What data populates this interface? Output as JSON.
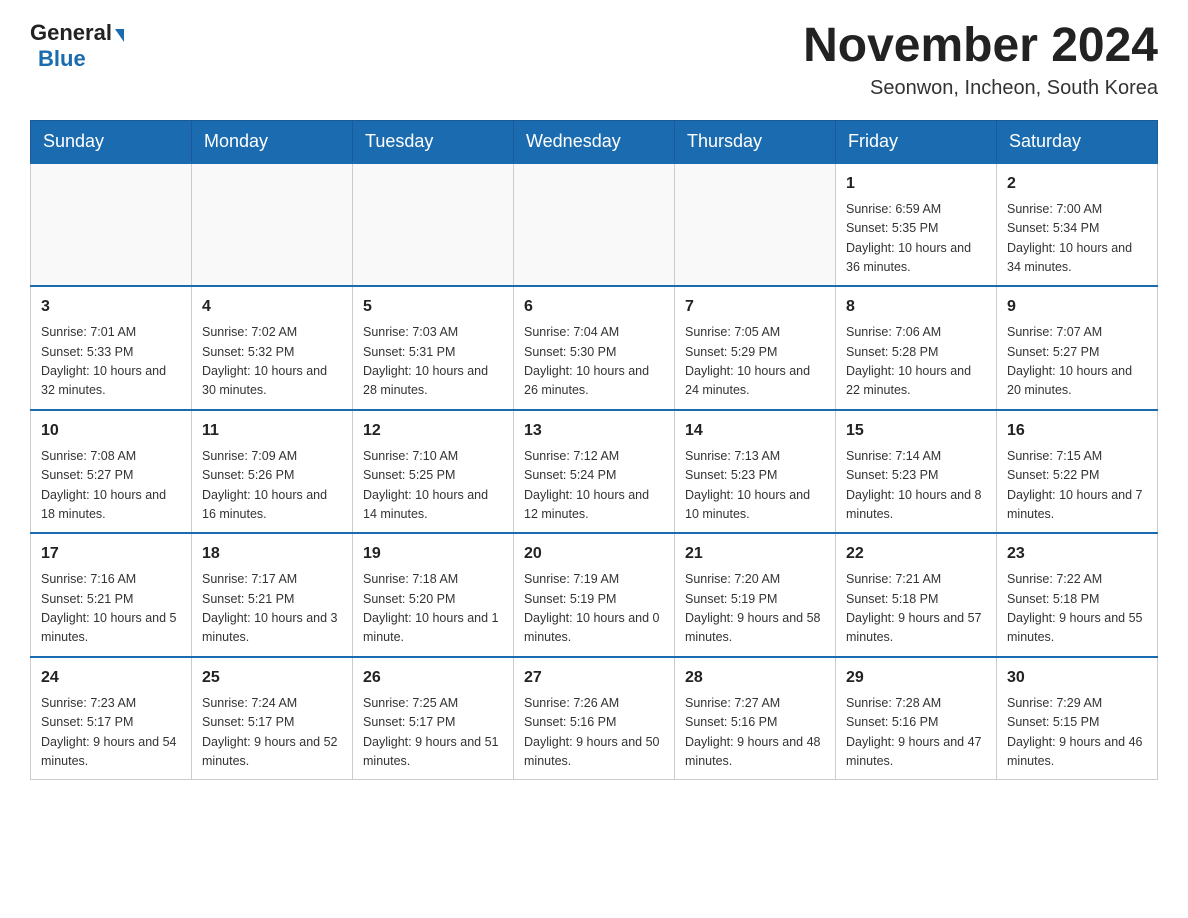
{
  "header": {
    "logo_general": "General",
    "logo_blue": "Blue",
    "month_title": "November 2024",
    "location": "Seonwon, Incheon, South Korea"
  },
  "weekdays": [
    "Sunday",
    "Monday",
    "Tuesday",
    "Wednesday",
    "Thursday",
    "Friday",
    "Saturday"
  ],
  "weeks": [
    {
      "days": [
        {
          "num": "",
          "info": ""
        },
        {
          "num": "",
          "info": ""
        },
        {
          "num": "",
          "info": ""
        },
        {
          "num": "",
          "info": ""
        },
        {
          "num": "",
          "info": ""
        },
        {
          "num": "1",
          "info": "Sunrise: 6:59 AM\nSunset: 5:35 PM\nDaylight: 10 hours\nand 36 minutes."
        },
        {
          "num": "2",
          "info": "Sunrise: 7:00 AM\nSunset: 5:34 PM\nDaylight: 10 hours\nand 34 minutes."
        }
      ]
    },
    {
      "days": [
        {
          "num": "3",
          "info": "Sunrise: 7:01 AM\nSunset: 5:33 PM\nDaylight: 10 hours\nand 32 minutes."
        },
        {
          "num": "4",
          "info": "Sunrise: 7:02 AM\nSunset: 5:32 PM\nDaylight: 10 hours\nand 30 minutes."
        },
        {
          "num": "5",
          "info": "Sunrise: 7:03 AM\nSunset: 5:31 PM\nDaylight: 10 hours\nand 28 minutes."
        },
        {
          "num": "6",
          "info": "Sunrise: 7:04 AM\nSunset: 5:30 PM\nDaylight: 10 hours\nand 26 minutes."
        },
        {
          "num": "7",
          "info": "Sunrise: 7:05 AM\nSunset: 5:29 PM\nDaylight: 10 hours\nand 24 minutes."
        },
        {
          "num": "8",
          "info": "Sunrise: 7:06 AM\nSunset: 5:28 PM\nDaylight: 10 hours\nand 22 minutes."
        },
        {
          "num": "9",
          "info": "Sunrise: 7:07 AM\nSunset: 5:27 PM\nDaylight: 10 hours\nand 20 minutes."
        }
      ]
    },
    {
      "days": [
        {
          "num": "10",
          "info": "Sunrise: 7:08 AM\nSunset: 5:27 PM\nDaylight: 10 hours\nand 18 minutes."
        },
        {
          "num": "11",
          "info": "Sunrise: 7:09 AM\nSunset: 5:26 PM\nDaylight: 10 hours\nand 16 minutes."
        },
        {
          "num": "12",
          "info": "Sunrise: 7:10 AM\nSunset: 5:25 PM\nDaylight: 10 hours\nand 14 minutes."
        },
        {
          "num": "13",
          "info": "Sunrise: 7:12 AM\nSunset: 5:24 PM\nDaylight: 10 hours\nand 12 minutes."
        },
        {
          "num": "14",
          "info": "Sunrise: 7:13 AM\nSunset: 5:23 PM\nDaylight: 10 hours\nand 10 minutes."
        },
        {
          "num": "15",
          "info": "Sunrise: 7:14 AM\nSunset: 5:23 PM\nDaylight: 10 hours\nand 8 minutes."
        },
        {
          "num": "16",
          "info": "Sunrise: 7:15 AM\nSunset: 5:22 PM\nDaylight: 10 hours\nand 7 minutes."
        }
      ]
    },
    {
      "days": [
        {
          "num": "17",
          "info": "Sunrise: 7:16 AM\nSunset: 5:21 PM\nDaylight: 10 hours\nand 5 minutes."
        },
        {
          "num": "18",
          "info": "Sunrise: 7:17 AM\nSunset: 5:21 PM\nDaylight: 10 hours\nand 3 minutes."
        },
        {
          "num": "19",
          "info": "Sunrise: 7:18 AM\nSunset: 5:20 PM\nDaylight: 10 hours\nand 1 minute."
        },
        {
          "num": "20",
          "info": "Sunrise: 7:19 AM\nSunset: 5:19 PM\nDaylight: 10 hours\nand 0 minutes."
        },
        {
          "num": "21",
          "info": "Sunrise: 7:20 AM\nSunset: 5:19 PM\nDaylight: 9 hours\nand 58 minutes."
        },
        {
          "num": "22",
          "info": "Sunrise: 7:21 AM\nSunset: 5:18 PM\nDaylight: 9 hours\nand 57 minutes."
        },
        {
          "num": "23",
          "info": "Sunrise: 7:22 AM\nSunset: 5:18 PM\nDaylight: 9 hours\nand 55 minutes."
        }
      ]
    },
    {
      "days": [
        {
          "num": "24",
          "info": "Sunrise: 7:23 AM\nSunset: 5:17 PM\nDaylight: 9 hours\nand 54 minutes."
        },
        {
          "num": "25",
          "info": "Sunrise: 7:24 AM\nSunset: 5:17 PM\nDaylight: 9 hours\nand 52 minutes."
        },
        {
          "num": "26",
          "info": "Sunrise: 7:25 AM\nSunset: 5:17 PM\nDaylight: 9 hours\nand 51 minutes."
        },
        {
          "num": "27",
          "info": "Sunrise: 7:26 AM\nSunset: 5:16 PM\nDaylight: 9 hours\nand 50 minutes."
        },
        {
          "num": "28",
          "info": "Sunrise: 7:27 AM\nSunset: 5:16 PM\nDaylight: 9 hours\nand 48 minutes."
        },
        {
          "num": "29",
          "info": "Sunrise: 7:28 AM\nSunset: 5:16 PM\nDaylight: 9 hours\nand 47 minutes."
        },
        {
          "num": "30",
          "info": "Sunrise: 7:29 AM\nSunset: 5:15 PM\nDaylight: 9 hours\nand 46 minutes."
        }
      ]
    }
  ]
}
